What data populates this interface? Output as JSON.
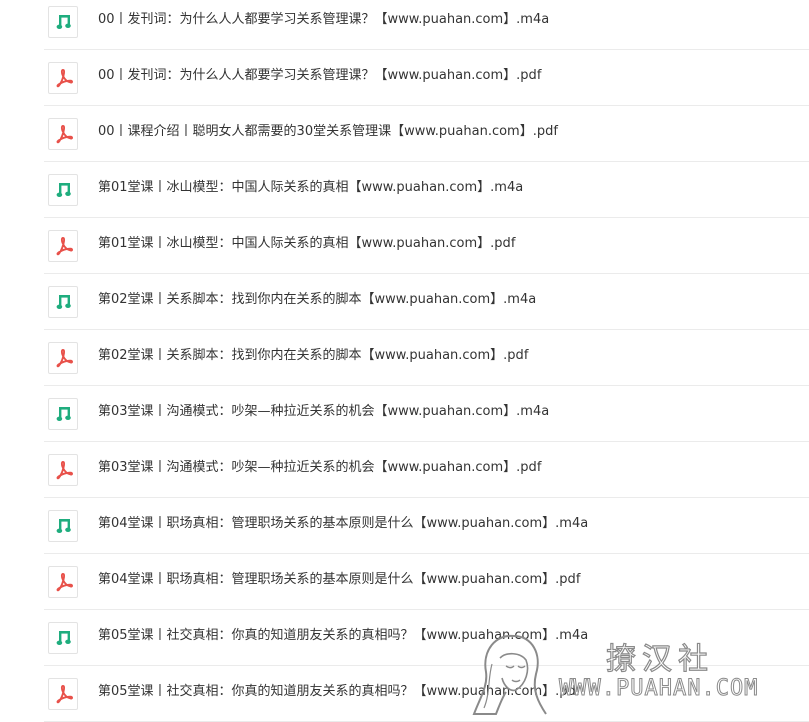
{
  "colors": {
    "audio_icon": "#1fad7e",
    "pdf_icon": "#e8514a",
    "row_text": "#333333",
    "divider": "#ebebeb"
  },
  "files": [
    {
      "name": "00丨发刊词：为什么人人都要学习关系管理课？【www.puahan.com】.m4a",
      "icon": "music-note-icon",
      "kind": "audio"
    },
    {
      "name": "00丨发刊词：为什么人人都要学习关系管理课？【www.puahan.com】.pdf",
      "icon": "pdf-icon",
      "kind": "pdf"
    },
    {
      "name": "00丨课程介绍丨聪明女人都需要的30堂关系管理课【www.puahan.com】.pdf",
      "icon": "pdf-icon",
      "kind": "pdf"
    },
    {
      "name": "第01堂课丨冰山模型：中国人际关系的真相【www.puahan.com】.m4a",
      "icon": "music-note-icon",
      "kind": "audio"
    },
    {
      "name": "第01堂课丨冰山模型：中国人际关系的真相【www.puahan.com】.pdf",
      "icon": "pdf-icon",
      "kind": "pdf"
    },
    {
      "name": "第02堂课丨关系脚本：找到你内在关系的脚本【www.puahan.com】.m4a",
      "icon": "music-note-icon",
      "kind": "audio"
    },
    {
      "name": "第02堂课丨关系脚本：找到你内在关系的脚本【www.puahan.com】.pdf",
      "icon": "pdf-icon",
      "kind": "pdf"
    },
    {
      "name": "第03堂课丨沟通模式：吵架—种拉近关系的机会【www.puahan.com】.m4a",
      "icon": "music-note-icon",
      "kind": "audio"
    },
    {
      "name": "第03堂课丨沟通模式：吵架—种拉近关系的机会【www.puahan.com】.pdf",
      "icon": "pdf-icon",
      "kind": "pdf"
    },
    {
      "name": "第04堂课丨职场真相：管理职场关系的基本原则是什么【www.puahan.com】.m4a",
      "icon": "music-note-icon",
      "kind": "audio"
    },
    {
      "name": "第04堂课丨职场真相：管理职场关系的基本原则是什么【www.puahan.com】.pdf",
      "icon": "pdf-icon",
      "kind": "pdf"
    },
    {
      "name": "第05堂课丨社交真相：你真的知道朋友关系的真相吗？【www.puahan.com】.m4a",
      "icon": "music-note-icon",
      "kind": "audio"
    },
    {
      "name": "第05堂课丨社交真相：你真的知道朋友关系的真相吗？【www.puahan.com】.pdf",
      "icon": "pdf-icon",
      "kind": "pdf"
    }
  ],
  "watermark": {
    "title": "撩汉社",
    "url": "WWW.PUAHAN.COM"
  }
}
